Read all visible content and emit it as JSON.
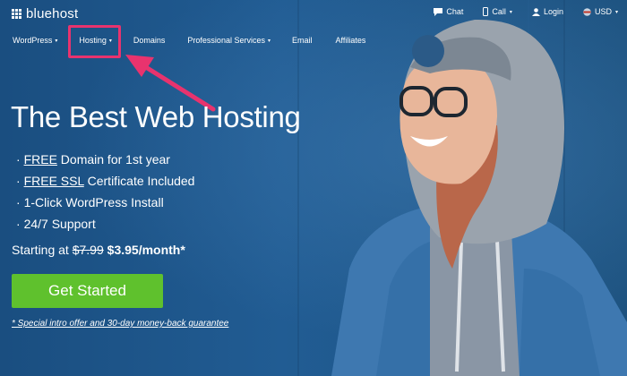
{
  "brand": {
    "name": "bluehost"
  },
  "utility_nav": {
    "chat": "Chat",
    "call": "Call",
    "login": "Login",
    "currency": "USD"
  },
  "main_nav": {
    "items": [
      {
        "label": "WordPress",
        "has_dropdown": true
      },
      {
        "label": "Hosting",
        "has_dropdown": true,
        "highlighted": true
      },
      {
        "label": "Domains",
        "has_dropdown": false
      },
      {
        "label": "Professional Services",
        "has_dropdown": true
      },
      {
        "label": "Email",
        "has_dropdown": false
      },
      {
        "label": "Affiliates",
        "has_dropdown": false
      }
    ]
  },
  "hero": {
    "title": "The Best Web Hosting",
    "features": [
      {
        "bullet": "·",
        "link": "FREE",
        "text": " Domain for 1st year"
      },
      {
        "bullet": "·",
        "link": "FREE SSL",
        "text": " Certificate Included"
      },
      {
        "bullet": "·",
        "link": "",
        "text": "1-Click WordPress Install"
      },
      {
        "bullet": "·",
        "link": "",
        "text": "24/7 Support"
      }
    ],
    "pricing": {
      "prefix": "Starting at",
      "old_price": "$7.99",
      "new_price": "$3.95/month*"
    },
    "cta_label": "Get Started",
    "disclaimer": "* Special intro offer and 30-day money-back guarantee"
  },
  "colors": {
    "background": "#1e5586",
    "cta": "#5fc12d",
    "highlight": "#e8336e"
  },
  "icons": [
    "logo-grid-icon",
    "chat-icon",
    "phone-icon",
    "user-icon",
    "flag-icon",
    "annotation-arrow-icon"
  ]
}
